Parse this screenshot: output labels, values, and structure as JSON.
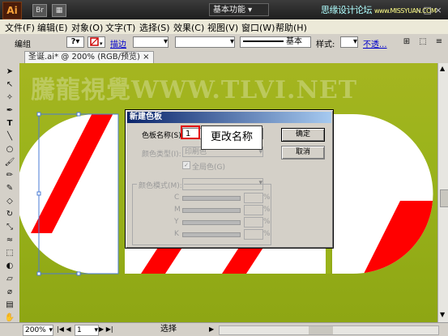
{
  "titlebar": {
    "logo": "Ai",
    "workspace_label": "基本功能",
    "watermark_site": "思缘设计论坛",
    "watermark_url": "www.MISSYUAN.COM",
    "window_controls": "-  □  ×"
  },
  "menu": [
    "文件(F)",
    "编辑(E)",
    "对象(O)",
    "文字(T)",
    "选择(S)",
    "效果(C)",
    "视图(V)",
    "窗口(W)",
    "帮助(H)"
  ],
  "control_bar": {
    "mode_label": "编组",
    "stroke_label": "描边",
    "stroke_profile": "基本",
    "style_label": "样式:",
    "opacity_label": "不透..."
  },
  "document_tab": "圣诞.ai* @ 200% (RGB/预览)",
  "canvas_watermark": "騰龍視覺WWW.TLVI.NET",
  "colors": {
    "red": "#ff0000",
    "canvas_green": "#9ab31b",
    "dialog_gray": "#d4d0c8"
  },
  "dialog": {
    "title": "新建色板",
    "swatch_name_label": "色板名称(S):",
    "swatch_name_value": "1",
    "color_type_label": "颜色类型(I):",
    "color_type_value": "印刷色",
    "global_label": "全局色(G)",
    "color_mode_label": "颜色模式(M):",
    "channels": [
      "C",
      "M",
      "Y",
      "K"
    ],
    "percent": "%",
    "ok_label": "确定",
    "cancel_label": "取消"
  },
  "annotation": "更改名称",
  "status": {
    "zoom": "200%",
    "page": "1",
    "tool": "选择"
  }
}
